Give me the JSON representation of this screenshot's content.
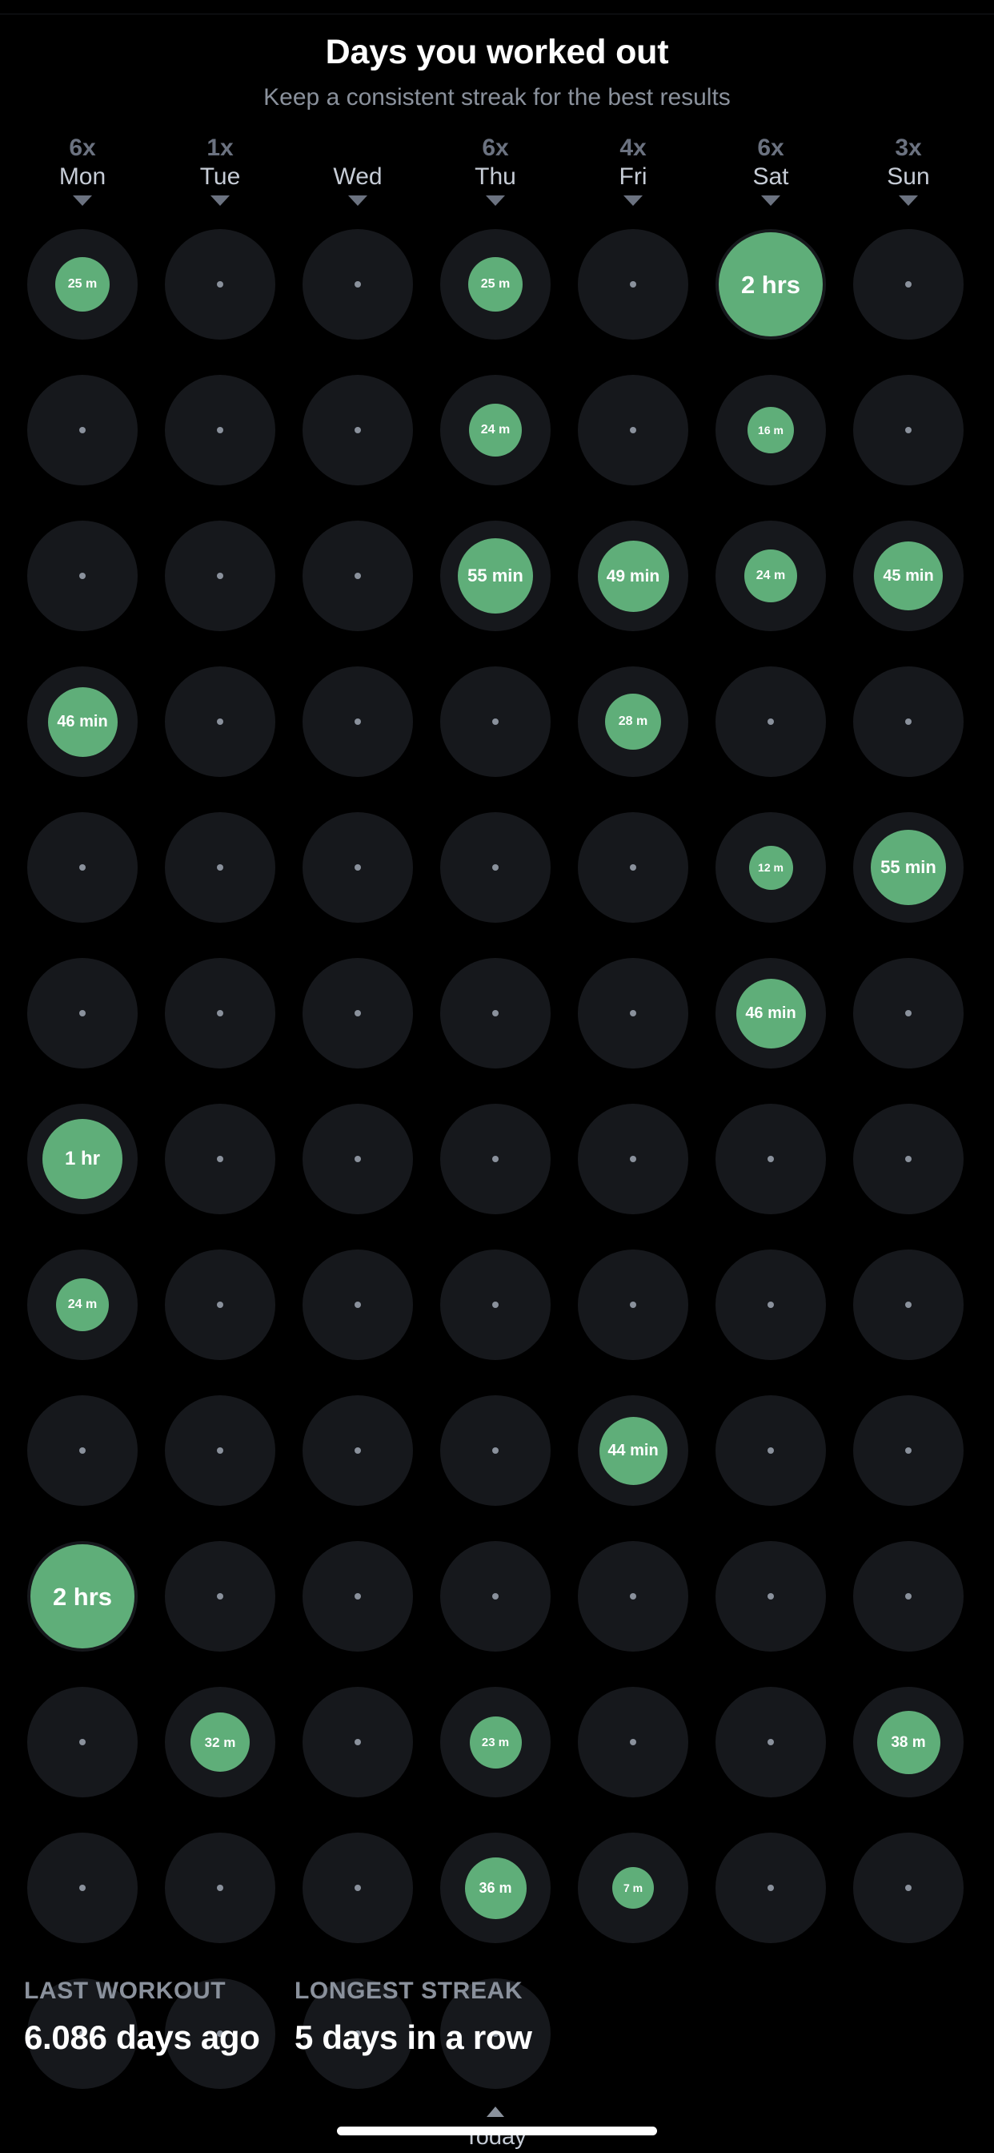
{
  "header": {
    "title": "Days you worked out",
    "subtitle": "Keep a consistent streak for the best results"
  },
  "colors": {
    "background": "#000000",
    "track": "#16181c",
    "accent_green": "#5fae79",
    "muted_text": "#8a919c",
    "day_name": "#c6ccd6",
    "day_count": "#6b7280",
    "value_text": "#ffffff"
  },
  "days": [
    {
      "count": "6x",
      "name": "Mon"
    },
    {
      "count": "1x",
      "name": "Tue"
    },
    {
      "count": "",
      "name": "Wed"
    },
    {
      "count": "6x",
      "name": "Thu"
    },
    {
      "count": "4x",
      "name": "Fri"
    },
    {
      "count": "6x",
      "name": "Sat"
    },
    {
      "count": "3x",
      "name": "Sun"
    }
  ],
  "today": {
    "label": "Today",
    "column_index": 3
  },
  "chart_data": {
    "type": "heatmap",
    "title": "Days you worked out",
    "subtitle": "Keep a consistent streak for the best results",
    "columns": [
      "Mon",
      "Tue",
      "Wed",
      "Thu",
      "Fri",
      "Sat",
      "Sun"
    ],
    "column_counts": [
      "6x",
      "1x",
      "",
      "6x",
      "4x",
      "6x",
      "3x"
    ],
    "legend": "Bubble diameter encodes workout duration; empty cells show a dot",
    "rows": [
      [
        {
          "label": "25 m",
          "minutes": 25,
          "size": 68
        },
        {
          "label": "",
          "minutes": 0,
          "size": 0
        },
        {
          "label": "",
          "minutes": 0,
          "size": 0
        },
        {
          "label": "25 m",
          "minutes": 25,
          "size": 68
        },
        {
          "label": "",
          "minutes": 0,
          "size": 0
        },
        {
          "label": "2 hrs",
          "minutes": 120,
          "size": 130
        },
        {
          "label": "",
          "minutes": 0,
          "size": 0
        }
      ],
      [
        {
          "label": "",
          "minutes": 0,
          "size": 0
        },
        {
          "label": "",
          "minutes": 0,
          "size": 0
        },
        {
          "label": "",
          "minutes": 0,
          "size": 0
        },
        {
          "label": "24 m",
          "minutes": 24,
          "size": 66
        },
        {
          "label": "",
          "minutes": 0,
          "size": 0
        },
        {
          "label": "16 m",
          "minutes": 16,
          "size": 58
        },
        {
          "label": "",
          "minutes": 0,
          "size": 0
        }
      ],
      [
        {
          "label": "",
          "minutes": 0,
          "size": 0
        },
        {
          "label": "",
          "minutes": 0,
          "size": 0
        },
        {
          "label": "",
          "minutes": 0,
          "size": 0
        },
        {
          "label": "55 min",
          "minutes": 55,
          "size": 94
        },
        {
          "label": "49 min",
          "minutes": 49,
          "size": 89
        },
        {
          "label": "24 m",
          "minutes": 24,
          "size": 66
        },
        {
          "label": "45 min",
          "minutes": 45,
          "size": 86
        }
      ],
      [
        {
          "label": "46 min",
          "minutes": 46,
          "size": 87
        },
        {
          "label": "",
          "minutes": 0,
          "size": 0
        },
        {
          "label": "",
          "minutes": 0,
          "size": 0
        },
        {
          "label": "",
          "minutes": 0,
          "size": 0
        },
        {
          "label": "28 m",
          "minutes": 28,
          "size": 70
        },
        {
          "label": "",
          "minutes": 0,
          "size": 0
        },
        {
          "label": "",
          "minutes": 0,
          "size": 0
        }
      ],
      [
        {
          "label": "",
          "minutes": 0,
          "size": 0
        },
        {
          "label": "",
          "minutes": 0,
          "size": 0
        },
        {
          "label": "",
          "minutes": 0,
          "size": 0
        },
        {
          "label": "",
          "minutes": 0,
          "size": 0
        },
        {
          "label": "",
          "minutes": 0,
          "size": 0
        },
        {
          "label": "12 m",
          "minutes": 12,
          "size": 55
        },
        {
          "label": "55 min",
          "minutes": 55,
          "size": 94
        }
      ],
      [
        {
          "label": "",
          "minutes": 0,
          "size": 0
        },
        {
          "label": "",
          "minutes": 0,
          "size": 0
        },
        {
          "label": "",
          "minutes": 0,
          "size": 0
        },
        {
          "label": "",
          "minutes": 0,
          "size": 0
        },
        {
          "label": "",
          "minutes": 0,
          "size": 0
        },
        {
          "label": "46 min",
          "minutes": 46,
          "size": 87
        },
        {
          "label": "",
          "minutes": 0,
          "size": 0
        }
      ],
      [
        {
          "label": "1 hr",
          "minutes": 60,
          "size": 100
        },
        {
          "label": "",
          "minutes": 0,
          "size": 0
        },
        {
          "label": "",
          "minutes": 0,
          "size": 0
        },
        {
          "label": "",
          "minutes": 0,
          "size": 0
        },
        {
          "label": "",
          "minutes": 0,
          "size": 0
        },
        {
          "label": "",
          "minutes": 0,
          "size": 0
        },
        {
          "label": "",
          "minutes": 0,
          "size": 0
        }
      ],
      [
        {
          "label": "24 m",
          "minutes": 24,
          "size": 66
        },
        {
          "label": "",
          "minutes": 0,
          "size": 0
        },
        {
          "label": "",
          "minutes": 0,
          "size": 0
        },
        {
          "label": "",
          "minutes": 0,
          "size": 0
        },
        {
          "label": "",
          "minutes": 0,
          "size": 0
        },
        {
          "label": "",
          "minutes": 0,
          "size": 0
        },
        {
          "label": "",
          "minutes": 0,
          "size": 0
        }
      ],
      [
        {
          "label": "",
          "minutes": 0,
          "size": 0
        },
        {
          "label": "",
          "minutes": 0,
          "size": 0
        },
        {
          "label": "",
          "minutes": 0,
          "size": 0
        },
        {
          "label": "",
          "minutes": 0,
          "size": 0
        },
        {
          "label": "44 min",
          "minutes": 44,
          "size": 85
        },
        {
          "label": "",
          "minutes": 0,
          "size": 0
        },
        {
          "label": "",
          "minutes": 0,
          "size": 0
        }
      ],
      [
        {
          "label": "2 hrs",
          "minutes": 120,
          "size": 130
        },
        {
          "label": "",
          "minutes": 0,
          "size": 0
        },
        {
          "label": "",
          "minutes": 0,
          "size": 0
        },
        {
          "label": "",
          "minutes": 0,
          "size": 0
        },
        {
          "label": "",
          "minutes": 0,
          "size": 0
        },
        {
          "label": "",
          "minutes": 0,
          "size": 0
        },
        {
          "label": "",
          "minutes": 0,
          "size": 0
        }
      ],
      [
        {
          "label": "",
          "minutes": 0,
          "size": 0
        },
        {
          "label": "32 m",
          "minutes": 32,
          "size": 74
        },
        {
          "label": "",
          "minutes": 0,
          "size": 0
        },
        {
          "label": "23 m",
          "minutes": 23,
          "size": 65
        },
        {
          "label": "",
          "minutes": 0,
          "size": 0
        },
        {
          "label": "",
          "minutes": 0,
          "size": 0
        },
        {
          "label": "38 m",
          "minutes": 38,
          "size": 79
        }
      ],
      [
        {
          "label": "",
          "minutes": 0,
          "size": 0
        },
        {
          "label": "",
          "minutes": 0,
          "size": 0
        },
        {
          "label": "",
          "minutes": 0,
          "size": 0
        },
        {
          "label": "36 m",
          "minutes": 36,
          "size": 77
        },
        {
          "label": "7 m",
          "minutes": 7,
          "size": 52
        },
        {
          "label": "",
          "minutes": 0,
          "size": 0
        },
        {
          "label": "",
          "minutes": 0,
          "size": 0
        }
      ],
      [
        {
          "label": "",
          "minutes": 0,
          "size": 0
        },
        {
          "label": "",
          "minutes": 0,
          "size": 0
        },
        {
          "label": "",
          "minutes": 0,
          "size": 0
        },
        {
          "label": "",
          "minutes": 0,
          "size": 0
        },
        null,
        null,
        null
      ]
    ]
  },
  "stats": [
    {
      "label": "LAST WORKOUT",
      "value": "6.086 days ago"
    },
    {
      "label": "LONGEST STREAK",
      "value": "5 days in a row"
    }
  ]
}
